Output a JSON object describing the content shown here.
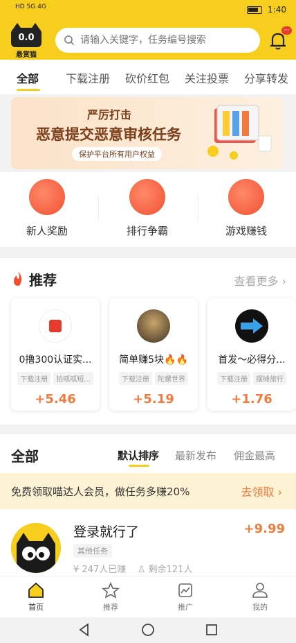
{
  "status": {
    "network_left": "HD 5G 4G",
    "time": "1:40"
  },
  "header": {
    "logo_text": "0.0",
    "logo_caption": "悬赏猫",
    "search_placeholder": "请输入关键字，任务编号搜索",
    "bell_badge": "···"
  },
  "tabs": [
    "全部",
    "下载注册",
    "砍价红包",
    "关注投票",
    "分享转发"
  ],
  "banner": {
    "line1": "严厉打击",
    "line2": "恶意提交恶意审核任务",
    "line3": "保护平台所有用户权益"
  },
  "quick": [
    {
      "label": "新人奖励",
      "icon": "gift-icon"
    },
    {
      "label": "排行争霸",
      "icon": "chart-icon"
    },
    {
      "label": "游戏赚钱",
      "icon": "gamepad-icon"
    }
  ],
  "recommend": {
    "title": "推荐",
    "more": "查看更多",
    "cards": [
      {
        "name": "0撸300认证实...",
        "tag1": "下载注册",
        "tag2": "拍呱呱短...",
        "price": "+5.46",
        "avatar_color": "#ffffff"
      },
      {
        "name": "简单赚5块🔥🔥",
        "tag1": "下载注册",
        "tag2": "陀螺世界",
        "price": "+5.19",
        "avatar_color": "#6b5a3e"
      },
      {
        "name": "首发～必得分...",
        "tag1": "下载注册",
        "tag2": "摆摊旅行",
        "price": "+1.76",
        "avatar_color": "#1a1a1a"
      }
    ]
  },
  "list": {
    "title": "全部",
    "sorts": [
      "默认排序",
      "最新发布",
      "佣金最高"
    ],
    "promo": {
      "text": "免费领取喵达人会员，做任务多赚20%",
      "action": "去领取"
    },
    "task": {
      "title": "登录就行了",
      "tag": "其他任务",
      "price": "+9.99",
      "earned": "247人已赚",
      "remaining": "剩余121人"
    }
  },
  "tabbar": [
    "首页",
    "推荐",
    "推广",
    "我的"
  ],
  "colors": {
    "brand": "#f7cd1e",
    "price": "#f07b3f"
  }
}
